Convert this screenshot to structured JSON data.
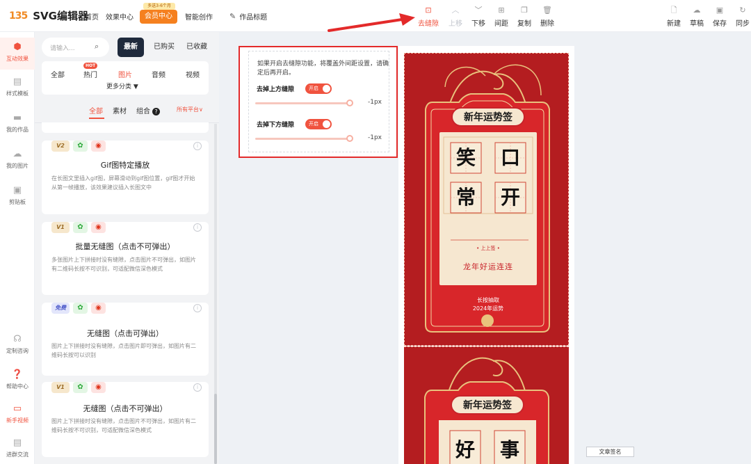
{
  "app": {
    "logo_mark": "135",
    "logo_text": "SVG编辑器",
    "nav": [
      "首页",
      "效果中心"
    ],
    "vip_badge": "多送3-6个月",
    "vip_label": "会员中心",
    "ai_label": "智能创作",
    "doc_title": "作品标题"
  },
  "toolbar": {
    "tools": [
      {
        "label": "去缝隙",
        "icon": "gap-remove-icon",
        "state": "active"
      },
      {
        "label": "上移",
        "icon": "chevron-up-icon",
        "state": "disabled"
      },
      {
        "label": "下移",
        "icon": "chevron-down-icon",
        "state": "normal"
      },
      {
        "label": "间距",
        "icon": "spacing-icon",
        "state": "normal"
      },
      {
        "label": "复制",
        "icon": "copy-icon",
        "state": "normal"
      },
      {
        "label": "删除",
        "icon": "trash-icon",
        "state": "normal"
      }
    ],
    "right": [
      {
        "label": "新建",
        "icon": "new-file-icon"
      },
      {
        "label": "草稿",
        "icon": "cloud-icon"
      },
      {
        "label": "保存",
        "icon": "save-icon"
      },
      {
        "label": "同步",
        "icon": "sync-icon"
      }
    ]
  },
  "rail": {
    "top": [
      "互动效果",
      "样式模板",
      "我的作品",
      "我的图片",
      "剪贴板"
    ],
    "bottom": [
      "定制咨询",
      "帮助中心",
      "新手视频",
      "进群交流"
    ]
  },
  "panel": {
    "search_placeholder": "请输入...",
    "tabs": [
      "最新",
      "已购买",
      "已收藏"
    ],
    "categories": [
      "全部",
      "热门",
      "图片",
      "音频",
      "视频"
    ],
    "hot_badge": "HOT",
    "more": "更多分类 ▼",
    "filters": [
      "全部",
      "素材",
      "组合"
    ],
    "filter_help": "?",
    "platform": "所有平台∨",
    "cards": [
      {
        "badge": "V2",
        "badge_type": "ver",
        "title": "Gif图特定播放",
        "desc": "在长图文里插入gif图，屏幕滑动到gif图位置，gif图才开始从第一帧播放，该效果建议插入长图文中"
      },
      {
        "badge": "V1",
        "badge_type": "ver",
        "title": "批量无缝图（点击不可弹出）",
        "desc": "多张图片上下拼接时没有缝隙，点击图片不可弹出，如图片有二维码长按不可识别，可适配微信深色模式"
      },
      {
        "badge": "免费",
        "badge_type": "free",
        "title": "无缝图（点击可弹出）",
        "desc": "图片上下拼接时没有缝隙，点击图片即可弹出，如图片有二维码长按可以识别"
      },
      {
        "badge": "V1",
        "badge_type": "ver",
        "title": "无缝图（点击不可弹出）",
        "desc": "图片上下拼接时没有缝隙，点击图片不可弹出，如图片有二维码长按不可识别，可适配微信深色模式"
      }
    ]
  },
  "settings": {
    "tip": "如果开启去缝隙功能，将覆盖外间距设置，请确定后再开启。",
    "rows": [
      {
        "label": "去掉上方缝隙",
        "toggle": "开启",
        "value": "-1px"
      },
      {
        "label": "去掉下方缝隙",
        "toggle": "开启",
        "value": "-1px"
      }
    ]
  },
  "poster": {
    "title": "新年运势签",
    "chars_top": [
      "笑",
      "口",
      "常",
      "开"
    ],
    "chars_bottom": [
      "好",
      "事"
    ],
    "rank": "• 上上签 •",
    "slogan": "龙年好运连连",
    "cta": "长按抽取",
    "year": "2024年运势"
  },
  "footer": {
    "stamp": "文章签名"
  },
  "colors": {
    "accent": "#f0533f",
    "poster_red": "#b41d20",
    "poster_cream": "#f6e7d0",
    "gold": "#e9c27d"
  }
}
